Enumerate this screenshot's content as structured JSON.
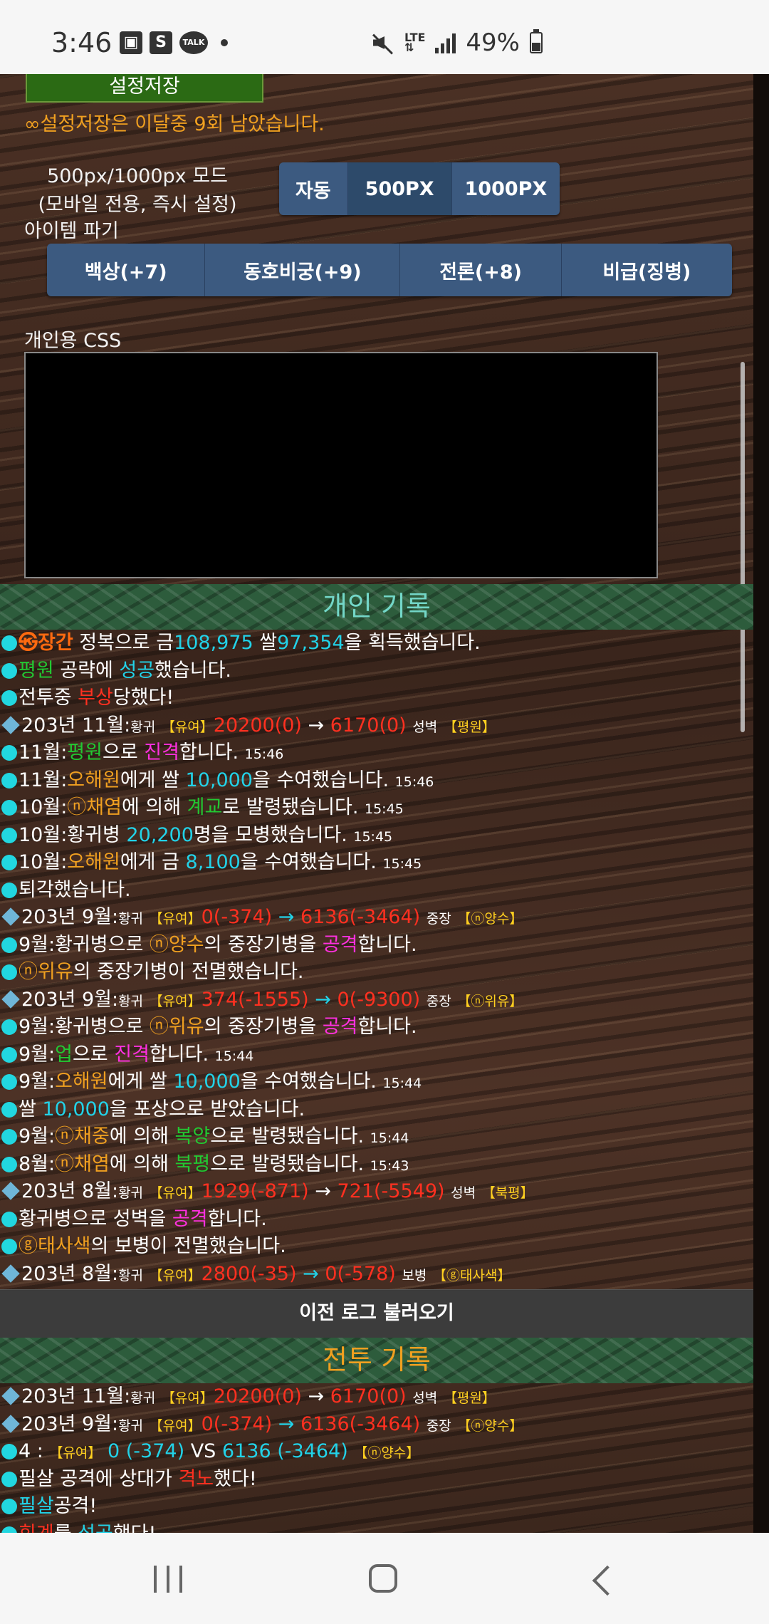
{
  "status_bar": {
    "time": "3:46",
    "app_icons": [
      "gallery-icon",
      "s-app-icon",
      "talk-icon"
    ],
    "talk_label": "TALK",
    "s_label": "S",
    "network": "LTE",
    "battery": "49%",
    "battery_level": 0.49
  },
  "settings": {
    "save_button": "설정저장",
    "save_note": "∞설정저장은 이달중 9회 남았습니다.",
    "mode_label_line1": "500px/1000px 모드",
    "mode_label_line2": "(모바일 전용, 즉시 설정)",
    "mode_options": [
      "자동",
      "500PX",
      "1000PX"
    ],
    "mode_selected": "500PX",
    "item_label": "아이템 파기",
    "items": [
      "백상(+7)",
      "동호비궁(+9)",
      "전론(+8)",
      "비급(징병)"
    ],
    "css_label": "개인용 CSS",
    "css_value": ""
  },
  "personal_log": {
    "title": "개인 기록",
    "load_previous": "이전 로그 불러오기"
  },
  "battle_log": {
    "title": "전투 기록"
  },
  "colors": {
    "cyan": "#22d2e8",
    "green": "#22c832",
    "red": "#ff3020",
    "magenta": "#ff30e0",
    "gold": "#f0a020",
    "orange": "#ff5010"
  }
}
